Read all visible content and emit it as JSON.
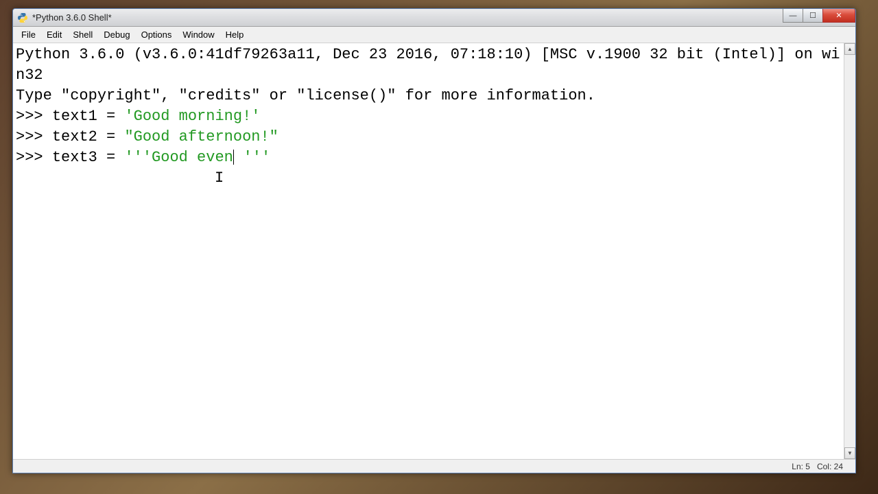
{
  "window": {
    "title": "*Python 3.6.0 Shell*"
  },
  "menu": {
    "items": [
      "File",
      "Edit",
      "Shell",
      "Debug",
      "Options",
      "Window",
      "Help"
    ]
  },
  "shell": {
    "banner_line1": "Python 3.6.0 (v3.6.0:41df79263a11, Dec 23 2016, 07:18:10) [MSC v.1900 32 bit (Intel)] on win32",
    "banner_line2": "Type \"copyright\", \"credits\" or \"license()\" for more information.",
    "prompt": ">>> ",
    "lines": [
      {
        "code": "text1 = ",
        "str": "'Good morning!'"
      },
      {
        "code": "text2 = ",
        "str": "\"Good afternoon!\""
      },
      {
        "code": "text3 = ",
        "str_before": "'''Good even",
        "str_after": " '''"
      }
    ]
  },
  "status": {
    "line": "Ln: 5",
    "col": "Col: 24"
  },
  "controls": {
    "minimize": "—",
    "maximize": "☐",
    "close": "✕"
  }
}
